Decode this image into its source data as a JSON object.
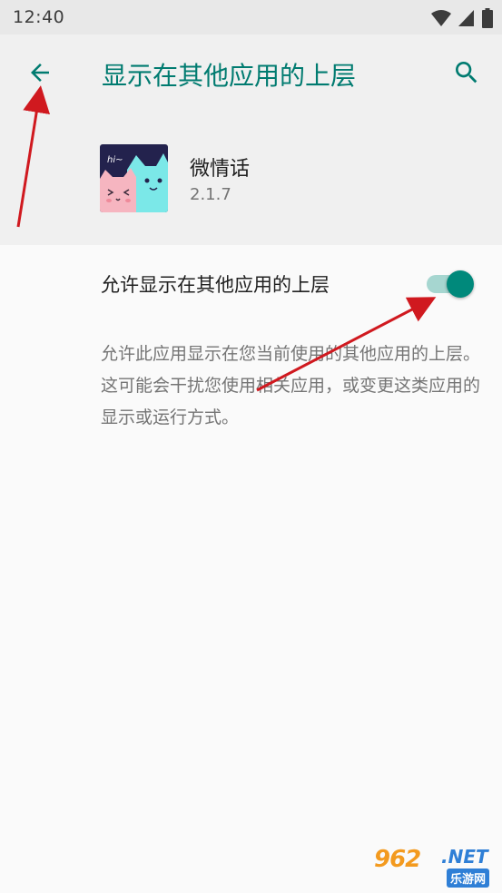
{
  "status_bar": {
    "time": "12:40"
  },
  "header": {
    "title": "显示在其他应用的上层",
    "back_icon": "arrow-back-icon",
    "search_icon": "search-icon"
  },
  "app": {
    "name": "微情话",
    "version": "2.1.7",
    "icon_text": "hi~"
  },
  "setting": {
    "label": "允许显示在其他应用的上层",
    "enabled": true,
    "description": "允许此应用显示在您当前使用的其他应用的上层。这可能会干扰您使用相关应用，或变更这类应用的显示或运行方式。"
  },
  "colors": {
    "accent": "#007b70",
    "toggle_thumb": "#00897b",
    "toggle_track": "#a6d6d0",
    "annotation_arrow": "#d0191f"
  },
  "watermark": {
    "number": "962",
    "domain": ".NET",
    "subtitle": "乐游网"
  }
}
